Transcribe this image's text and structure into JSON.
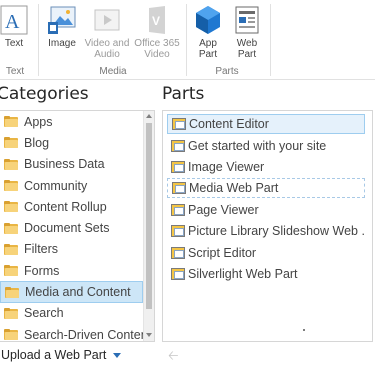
{
  "ribbon": {
    "buttons": [
      {
        "label": "Text",
        "icon": "text-icon",
        "disabled": false
      },
      {
        "label": "Image",
        "icon": "image-icon",
        "disabled": false
      },
      {
        "label": "Video and\nAudio",
        "icon": "video-audio-icon",
        "disabled": true
      },
      {
        "label": "Office 365\nVideo",
        "icon": "office365-video-icon",
        "disabled": true
      },
      {
        "label": "App\nPart",
        "icon": "app-part-icon",
        "disabled": false
      },
      {
        "label": "Web\nPart",
        "icon": "web-part-icon",
        "disabled": false
      }
    ],
    "groups": {
      "text": "Text",
      "media": "Media",
      "parts": "Parts"
    }
  },
  "categories": {
    "heading": "Categories",
    "items": [
      "Apps",
      "Blog",
      "Business Data",
      "Community",
      "Content Rollup",
      "Document Sets",
      "Filters",
      "Forms",
      "Media and Content",
      "Search",
      "Search-Driven Content"
    ],
    "selected": "Media and Content"
  },
  "parts": {
    "heading": "Parts",
    "items": [
      "Content Editor",
      "Get started with your site",
      "Image Viewer",
      "Media Web Part",
      "Page Viewer",
      "Picture Library Slideshow Web ...",
      "Script Editor",
      "Silverlight Web Part"
    ],
    "selected": "Content Editor"
  },
  "footer": {
    "upload_label": "Upload a Web Part"
  },
  "colors": {
    "accent": "#0072c6",
    "selection_bg": "#cde6f7",
    "selection_border": "#9ecdef",
    "folder": "#f7d37a"
  }
}
